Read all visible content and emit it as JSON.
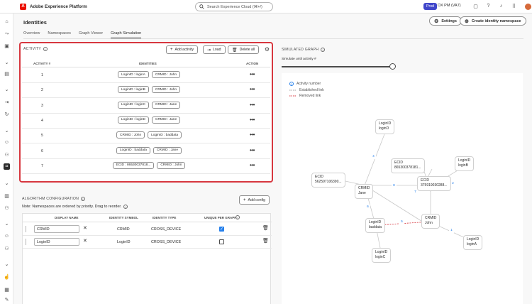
{
  "app": {
    "title": "Adobe Experience Platform",
    "logo_letter": "A"
  },
  "search": {
    "placeholder": "Search Experience Cloud (⌘+/)"
  },
  "org": {
    "badge": "Prod",
    "name": "DX PM (VA7)"
  },
  "page": {
    "title": "Identities",
    "settings_label": "Settings",
    "create_label": "Create identity namespace",
    "tabs": [
      {
        "label": "Overview"
      },
      {
        "label": "Namespaces"
      },
      {
        "label": "Graph Viewer"
      },
      {
        "label": "Graph Simulation",
        "active": true
      }
    ]
  },
  "activity": {
    "title": "ACTIVITY",
    "add_label": "Add activity",
    "load_label": "Load",
    "delete_label": "Delete all",
    "headers": {
      "num": "ACTIVITY #",
      "identities": "IDENTITIES",
      "action": "ACTION"
    },
    "rows": [
      {
        "num": "1",
        "ids": [
          "LoginID : loginA",
          "CRMID : John"
        ]
      },
      {
        "num": "2",
        "ids": [
          "LoginID : loginB",
          "CRMID : John"
        ]
      },
      {
        "num": "3",
        "ids": [
          "LoginID : loginC",
          "CRMID : Jane"
        ]
      },
      {
        "num": "4",
        "ids": [
          "LoginID : loginD",
          "CRMID : Jane"
        ]
      },
      {
        "num": "5",
        "ids": [
          "CRMID : John",
          "LoginID : baddata"
        ]
      },
      {
        "num": "6",
        "ids": [
          "LoginID : baddata",
          "CRMID : Jane"
        ]
      },
      {
        "num": "7",
        "ids": [
          "ECID : 86530037818...",
          "CRMID : John"
        ]
      }
    ]
  },
  "algorithm": {
    "title": "ALGORITHM CONFIGURATION",
    "note": "Note: Namespaces are ordered by priority. Drag to reorder.",
    "add_label": "Add config",
    "headers": {
      "name": "DISPLAY NAME",
      "symbol": "IDENTITY SYMBOL",
      "type": "IDENTITY TYPE",
      "unique": "UNIQUE PER GRAPH"
    },
    "rows": [
      {
        "name": "CRMID",
        "symbol": "CRMID",
        "type": "CROSS_DEVICE",
        "unique": true
      },
      {
        "name": "LoginID",
        "symbol": "LoginID",
        "type": "CROSS_DEVICE",
        "unique": false
      }
    ]
  },
  "graph": {
    "title": "SIMULATED GRAPH",
    "simulate_label": "Simulate until activity #",
    "slider_value": 7,
    "legend": {
      "activity": "Activity number",
      "established": "Established link",
      "removed": "Removed link"
    },
    "legend_num": "1",
    "nodes": {
      "loginD": [
        "LoginID",
        "loginD"
      ],
      "ecid1": [
        "ECID",
        "865300378181..."
      ],
      "loginB": [
        "LoginID",
        "loginB"
      ],
      "ecid2": [
        "ECID",
        "562597106390..."
      ],
      "jane": [
        "CRMID",
        "Jane"
      ],
      "ecid3": [
        "ECID",
        "375919030288..."
      ],
      "baddata": [
        "LoginID",
        "baddata"
      ],
      "john": [
        "CRMID",
        "John"
      ],
      "loginA": [
        "LoginID",
        "loginA"
      ],
      "loginC": [
        "LoginID",
        "loginC"
      ]
    },
    "edge_labels": {
      "e4": "4",
      "e8": "8",
      "e7": "7",
      "e2": "2",
      "e6": "6",
      "e5": "5",
      "e1": "1",
      "e3": "3"
    }
  },
  "colors": {
    "accent": "#2680eb",
    "highlight": "#d7373f",
    "prod": "#4046ca",
    "brand": "#eb1000"
  }
}
